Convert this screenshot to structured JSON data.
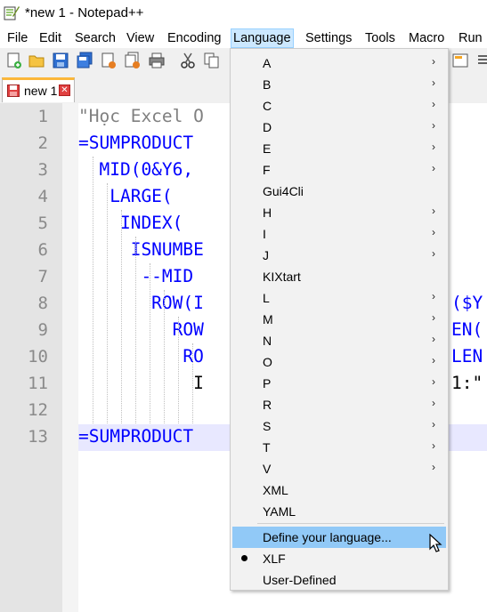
{
  "window": {
    "title": "*new 1 - Notepad++"
  },
  "menubar": {
    "items": [
      "File",
      "Edit",
      "Search",
      "View",
      "Encoding",
      "Language",
      "Settings",
      "Tools",
      "Macro",
      "Run"
    ]
  },
  "tab": {
    "label": "new 1",
    "close": "✕"
  },
  "editor": {
    "line_numbers": [
      "1",
      "2",
      "3",
      "4",
      "5",
      "6",
      "7",
      "8",
      "9",
      "10",
      "11",
      "12",
      "13"
    ],
    "lines": [
      {
        "text": "\"Học Excel O",
        "kind": "str"
      },
      {
        "text": "=SUMPRODUCT",
        "kind": "kw"
      },
      {
        "text": "  MID(0&Y6,",
        "kind": "kw"
      },
      {
        "text": "   LARGE(",
        "kind": "kw"
      },
      {
        "text": "    INDEX(",
        "kind": "kw"
      },
      {
        "text": "     ISNUMBE",
        "kind": "kw"
      },
      {
        "text": "      --MID",
        "kind": "kw"
      },
      {
        "text": "       ROW(I",
        "kind": "kw"
      },
      {
        "text": "         ROW",
        "kind": "kw"
      },
      {
        "text": "          RO",
        "kind": "kw"
      },
      {
        "text": "           I",
        "kind": "blk"
      },
      {
        "text": "",
        "kind": "blk"
      },
      {
        "text": "=SUMPRODUCT",
        "kind": "kw"
      }
    ],
    "right_fragments": [
      {
        "line": 8,
        "text": "($Y"
      },
      {
        "line": 9,
        "text": "EN("
      },
      {
        "line": 10,
        "text": "LEN"
      },
      {
        "line": 11,
        "text": "1:\""
      }
    ]
  },
  "language_menu": {
    "items": [
      {
        "label": "A",
        "submenu": true
      },
      {
        "label": "B",
        "submenu": true
      },
      {
        "label": "C",
        "submenu": true
      },
      {
        "label": "D",
        "submenu": true
      },
      {
        "label": "E",
        "submenu": true
      },
      {
        "label": "F",
        "submenu": true
      },
      {
        "label": "Gui4Cli",
        "submenu": false
      },
      {
        "label": "H",
        "submenu": true
      },
      {
        "label": "I",
        "submenu": true
      },
      {
        "label": "J",
        "submenu": true
      },
      {
        "label": "KIXtart",
        "submenu": false
      },
      {
        "label": "L",
        "submenu": true
      },
      {
        "label": "M",
        "submenu": true
      },
      {
        "label": "N",
        "submenu": true
      },
      {
        "label": "O",
        "submenu": true
      },
      {
        "label": "P",
        "submenu": true
      },
      {
        "label": "R",
        "submenu": true
      },
      {
        "label": "S",
        "submenu": true
      },
      {
        "label": "T",
        "submenu": true
      },
      {
        "label": "V",
        "submenu": true
      },
      {
        "label": "XML",
        "submenu": false
      },
      {
        "label": "YAML",
        "submenu": false
      }
    ],
    "define_label": "Define your language...",
    "xlf_label": "XLF",
    "user_defined_label": "User-Defined",
    "arrow_glyph": "›",
    "hover_color": "#91c9f7"
  }
}
